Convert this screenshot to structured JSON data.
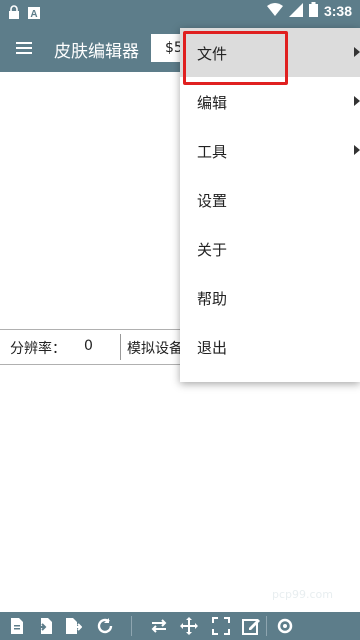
{
  "status_bar": {
    "time": "3:38"
  },
  "app_bar": {
    "title": "皮肤编辑器",
    "resolution_value": "$5"
  },
  "info_bar": {
    "resolution_label": "分辨率：",
    "resolution_value": "0",
    "device_label": "模拟设备"
  },
  "menu": {
    "items": [
      {
        "label": "文件",
        "has_submenu": true
      },
      {
        "label": "编辑",
        "has_submenu": true
      },
      {
        "label": "工具",
        "has_submenu": true
      },
      {
        "label": "设置",
        "has_submenu": false
      },
      {
        "label": "关于",
        "has_submenu": false
      },
      {
        "label": "帮助",
        "has_submenu": false
      },
      {
        "label": "退出",
        "has_submenu": false
      }
    ]
  },
  "toolbar_icons": [
    "new-file-icon",
    "import-icon",
    "export-icon",
    "refresh-icon",
    "swap-icon",
    "move-icon",
    "fullscreen-icon",
    "edit-icon",
    "settings-icon"
  ],
  "watermark": "pcp99.com",
  "colors": {
    "primary": "#5d7d8a",
    "highlight": "#dcdcdc",
    "annotation": "#e02020"
  }
}
